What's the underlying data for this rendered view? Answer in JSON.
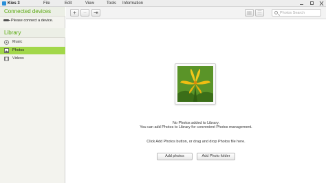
{
  "app": {
    "title": "Kies 3"
  },
  "menu": [
    "File",
    "Edit",
    "View",
    "Tools",
    "Information"
  ],
  "window_controls": {
    "minimize": "–",
    "maximize": "□",
    "close": "✕"
  },
  "sidebar": {
    "connected_header": "Connected devices",
    "device_status": "Please connect a device.",
    "library_header": "Library",
    "items": [
      {
        "label": "Music",
        "icon": "music-icon",
        "active": false
      },
      {
        "label": "Photos",
        "icon": "photo-icon",
        "active": true
      },
      {
        "label": "Videos",
        "icon": "video-icon",
        "active": false
      }
    ],
    "active_color": "#a2d74a",
    "header_text_color": "#58a80e"
  },
  "toolbar": {
    "add_icon": "+",
    "remove_icon": "−",
    "export_icon": "⇥",
    "grid_icon": "▦",
    "list_icon": "☰",
    "search_placeholder": "Photos Search"
  },
  "main": {
    "empty_title": "No Photos added to Library.",
    "empty_desc": "You can add Photos to Library for convenient Photos management.",
    "empty_hint": "Click Add Photos button, or drag and drop Photos file here.",
    "add_photos_label": "Add photos",
    "add_folder_label": "Add Photo folder"
  }
}
